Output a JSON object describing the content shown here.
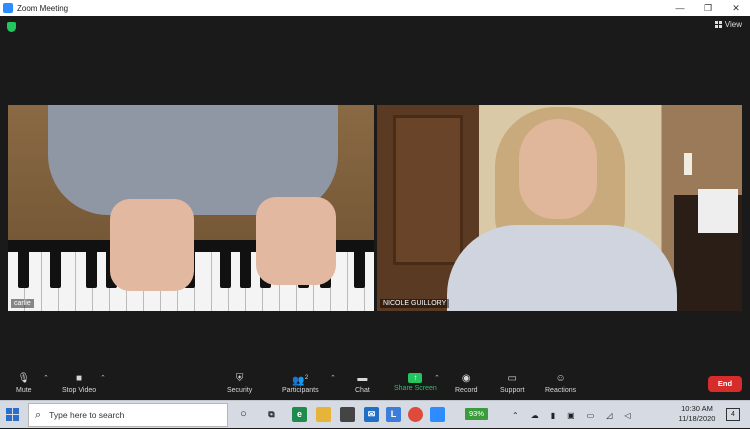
{
  "window": {
    "title": "Zoom Meeting"
  },
  "header": {
    "view_label": "View"
  },
  "videos": {
    "left_name": "carlie",
    "right_name": "NICOLE GUILLORY"
  },
  "toolbar": {
    "mute_label": "Mute",
    "stop_video_label": "Stop Video",
    "security_label": "Security",
    "participants_label": "Participants",
    "participants_count": "2",
    "chat_label": "Chat",
    "share_screen_label": "Share Screen",
    "record_label": "Record",
    "support_label": "Support",
    "reactions_label": "Reactions",
    "end_label": "End",
    "share_color": "#23c55e",
    "end_color": "#d62c2c"
  },
  "taskbar": {
    "search_placeholder": "Type here to search",
    "battery": "93%",
    "time": "10:30 AM",
    "date": "11/18/2020",
    "notifications": "4"
  },
  "icons": [
    "shield-icon",
    "grid-icon",
    "mic-icon",
    "camera-icon",
    "lock-icon",
    "people-icon",
    "chat-icon",
    "share-icon",
    "record-icon",
    "support-icon",
    "reactions-icon",
    "windows-start-icon",
    "search-icon"
  ]
}
